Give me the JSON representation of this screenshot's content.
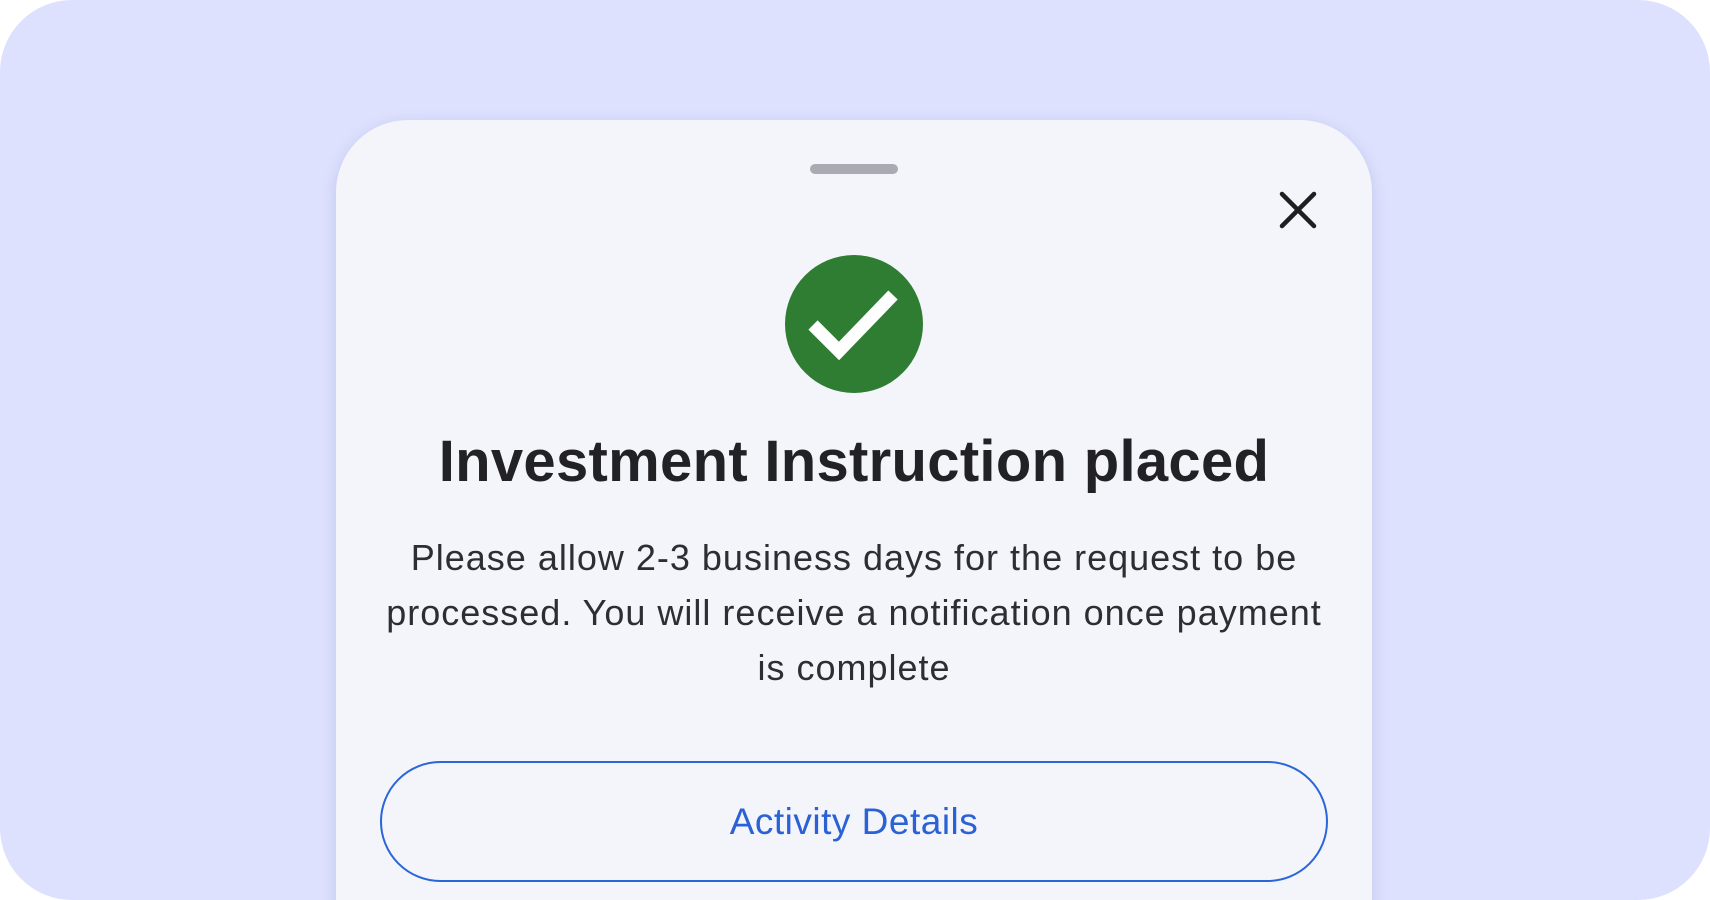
{
  "modal": {
    "title": "Investment Instruction placed",
    "message": "Please allow 2-3 business days for the request to be processed. You will receive a notification once payment is complete",
    "primary_action_label": "Activity Details",
    "close_icon": "close-icon",
    "status_icon": "check-circle-icon"
  },
  "colors": {
    "background": "#dde1fd",
    "sheet": "#f4f4fb",
    "success": "#2e7d32",
    "accent": "#2a66d9",
    "text": "#222226"
  }
}
